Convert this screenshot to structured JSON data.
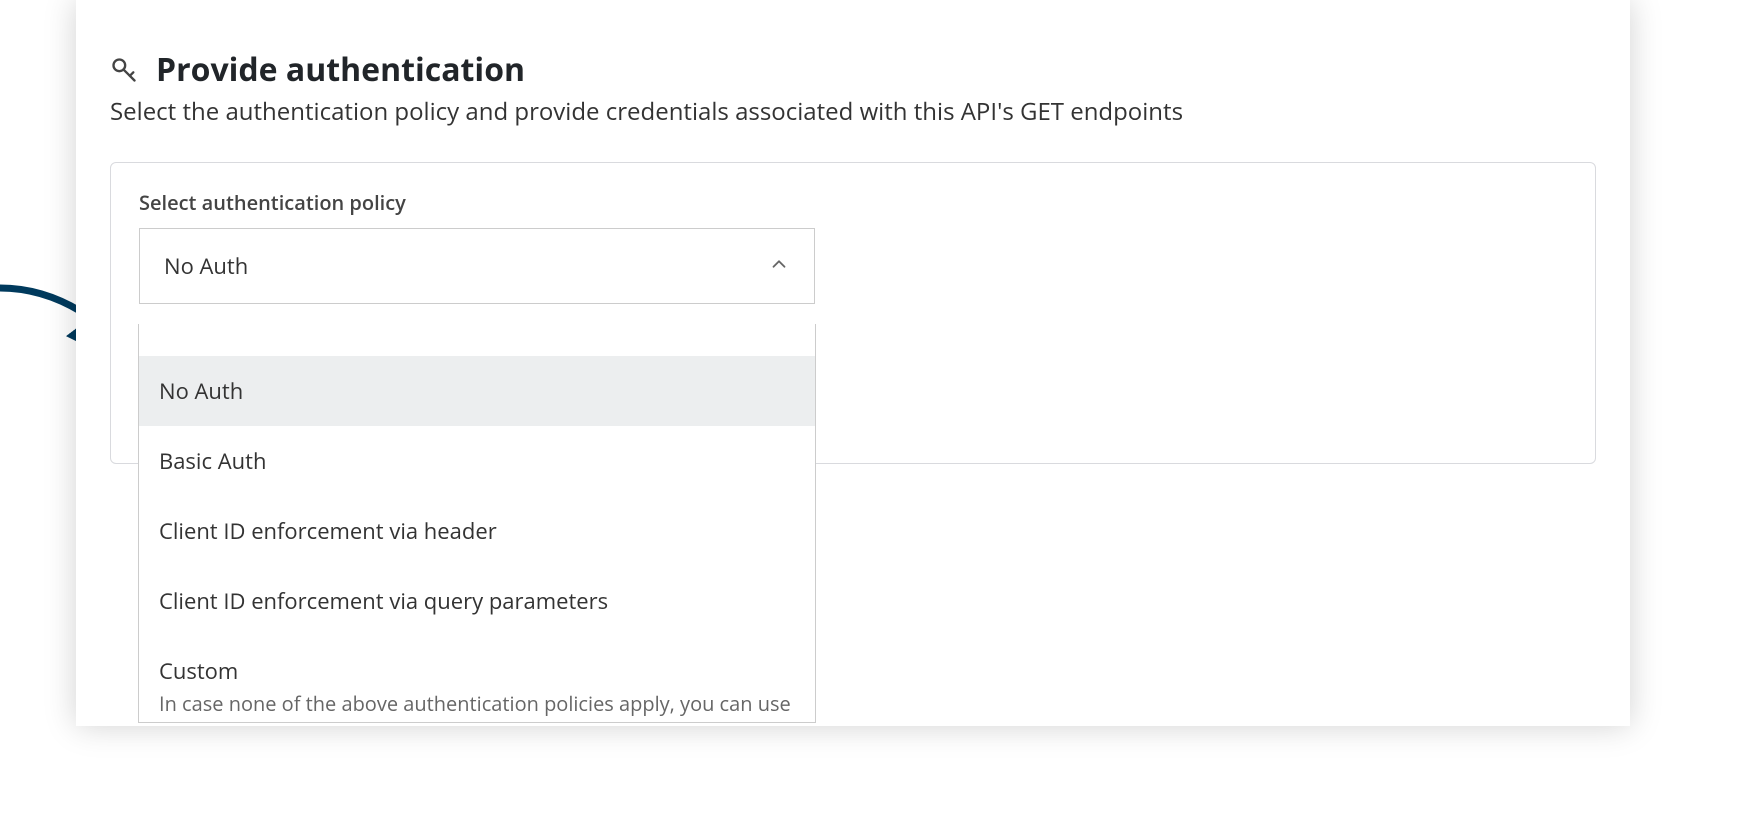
{
  "header": {
    "title": "Provide authentication",
    "subtitle": "Select the authentication policy and provide credentials associated with this API's GET endpoints"
  },
  "policy": {
    "label": "Select authentication policy",
    "selected": "No Auth",
    "options": {
      "0": {
        "label": "No Auth"
      },
      "1": {
        "label": "Basic Auth"
      },
      "2": {
        "label": "Client ID enforcement via header"
      },
      "3": {
        "label": "Client ID enforcement via query parameters"
      },
      "4": {
        "label": "Custom",
        "desc": "In case none of the above authentication policies apply, you can use this option to add custom header parameters and"
      }
    }
  }
}
